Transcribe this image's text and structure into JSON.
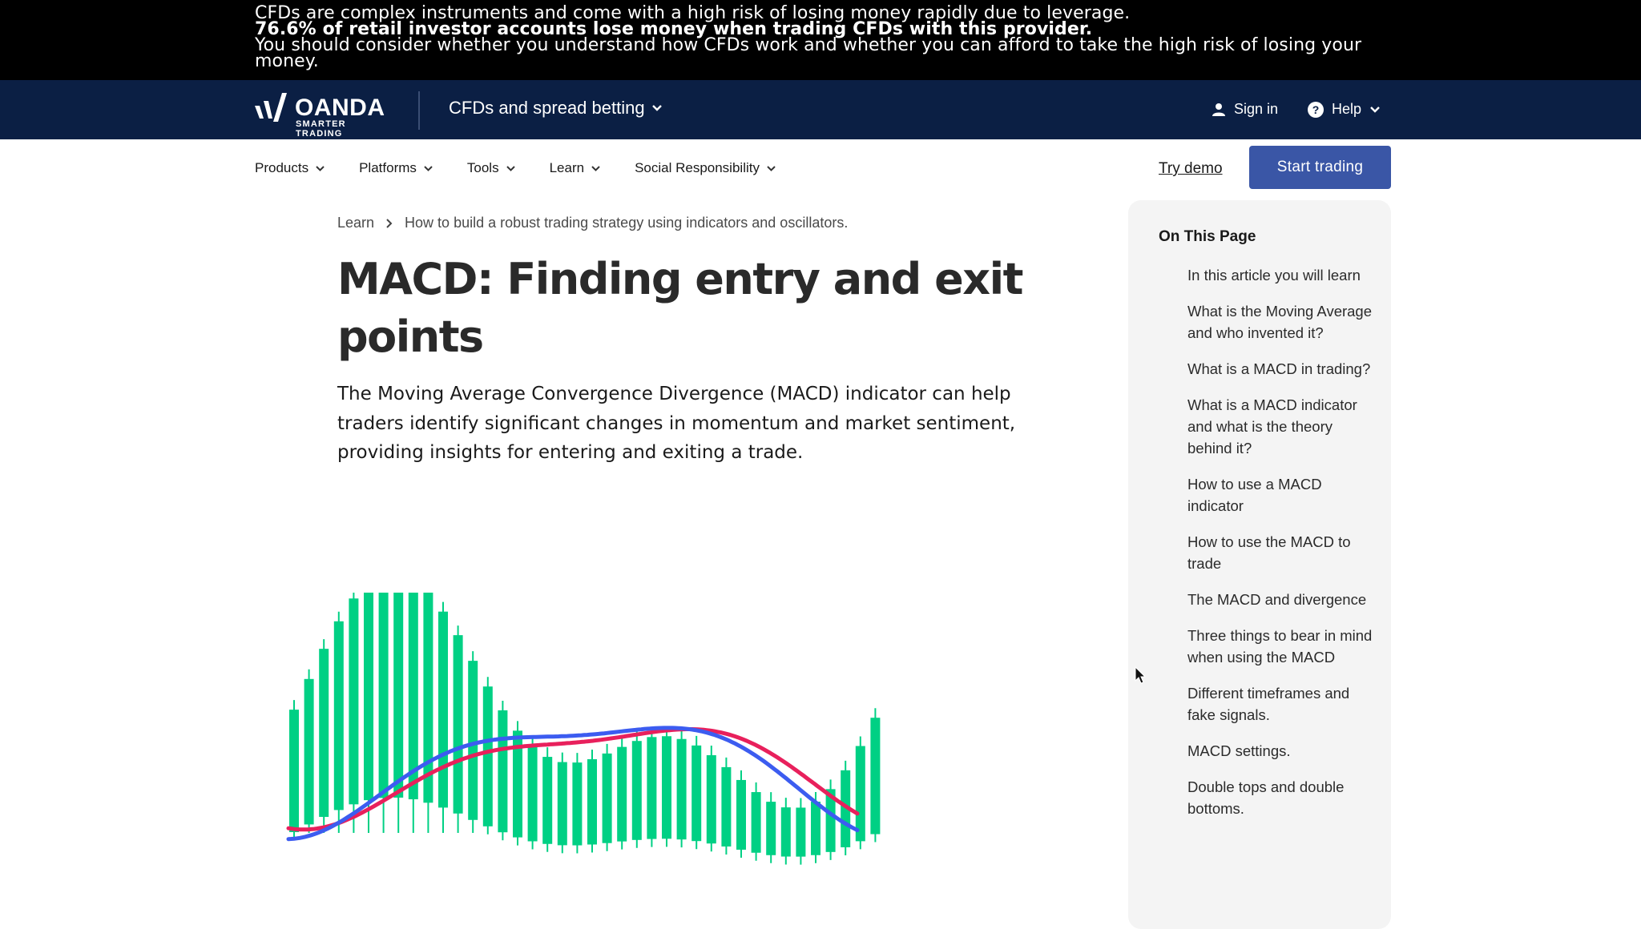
{
  "risk_warning": {
    "line1": "CFDs are complex instruments and come with a high risk of losing money rapidly due to leverage.",
    "line2": "76.6% of retail investor accounts lose money when trading CFDs with this provider.",
    "line3": "You should consider whether you understand how CFDs work and whether you can afford to take the high risk of losing your",
    "line4": "money."
  },
  "header": {
    "brand": "OANDA",
    "tagline": "SMARTER TRADING",
    "product_switch": "CFDs and spread betting",
    "sign_in": "Sign in",
    "help": "Help"
  },
  "nav": {
    "items": [
      {
        "label": "Products"
      },
      {
        "label": "Platforms"
      },
      {
        "label": "Tools"
      },
      {
        "label": "Learn"
      },
      {
        "label": "Social Responsibility"
      }
    ],
    "try_demo": "Try demo",
    "start_trading": "Start trading"
  },
  "breadcrumb": {
    "root": "Learn",
    "current": "How to build a robust trading strategy using indicators and oscillators."
  },
  "article": {
    "title": "MACD: Finding entry and exit points",
    "intro": "The Moving Average Convergence Divergence (MACD) indicator can help traders identify significant changes in momentum and market sentiment, providing insights for entering and exiting a trade."
  },
  "toc": {
    "heading": "On This Page",
    "items": [
      "In this article you will learn",
      "What is the Moving Average and who invented it?",
      "What is a MACD in trading?",
      "What is a MACD indicator and what is the theory behind it?",
      "How to use a MACD indicator",
      "How to use the MACD to trade",
      "The MACD and divergence",
      "Three things to bear in mind when using the MACD",
      "Different timeframes and fake signals.",
      "MACD settings.",
      "Double tops and double bottoms."
    ]
  },
  "colors": {
    "banner_bg": "#000000",
    "nav_bg": "#0b1f44",
    "accent_button": "#3a56a6",
    "candle": "#00d084",
    "line_fast": "#3c5cf0",
    "line_slow": "#e8205c"
  }
}
